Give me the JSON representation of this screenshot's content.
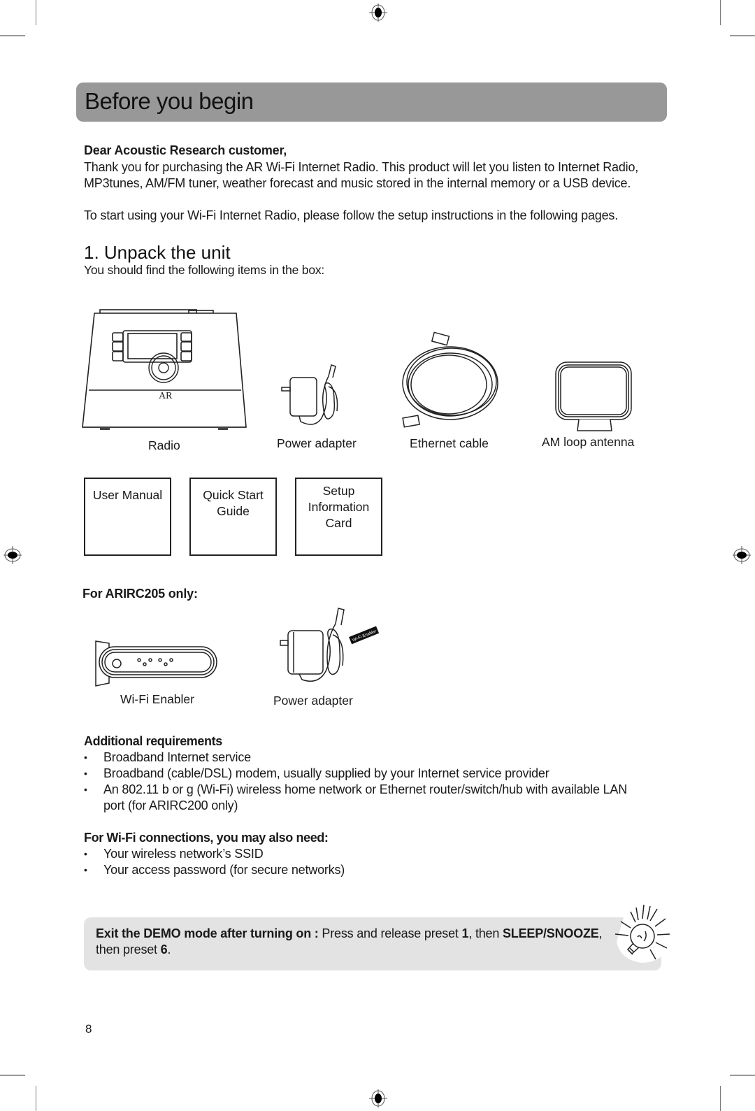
{
  "page": {
    "title": "Before you begin",
    "page_number": "8"
  },
  "intro": {
    "greeting": "Dear Acoustic Research customer,",
    "line1": "Thank you for purchasing the AR Wi-Fi Internet Radio. This product will let you listen to Internet Radio,",
    "line2": "MP3tunes, AM/FM tuner, weather forecast and music stored in the internal memory or a USB device.",
    "line3": "To start using your Wi-Fi Internet Radio, please follow the setup instructions in the following pages."
  },
  "unpack": {
    "heading": "1. Unpack the unit",
    "subheading": "You should find the following items in the box:",
    "items": [
      {
        "label": "Radio",
        "icon": "radio-illustration"
      },
      {
        "label": "Power adapter",
        "icon": "power-adapter-illustration"
      },
      {
        "label": "Ethernet cable",
        "icon": "ethernet-cable-illustration"
      },
      {
        "label": "AM loop antenna",
        "icon": "am-loop-antenna-illustration"
      }
    ],
    "documents": [
      {
        "lines": [
          "User Manual"
        ]
      },
      {
        "lines": [
          "Quick Start",
          "Guide"
        ]
      },
      {
        "lines": [
          "Setup",
          "Information",
          "Card"
        ]
      }
    ],
    "model_only_heading": "For ARIRC205 only:",
    "model_only_items": [
      {
        "label": "Wi-Fi Enabler",
        "icon": "wifi-enabler-illustration"
      },
      {
        "label": "Power adapter",
        "icon": "power-adapter-illustration",
        "tag_text": "Wi-Fi Enabler"
      }
    ]
  },
  "requirements": {
    "heading": "Additional requirements",
    "items": [
      "Broadband Internet service",
      "Broadband (cable/DSL) modem, usually supplied by your Internet service provider",
      "An 802.11 b or g (Wi-Fi) wireless home network or Ethernet router/switch/hub with available LAN",
      "port (for ARIRC200 only)"
    ]
  },
  "wifi_needs": {
    "heading": "For Wi-Fi connections, you may also need:",
    "items": [
      "Your wireless network’s SSID",
      "Your access password (for secure networks)"
    ]
  },
  "note": {
    "lead": "Exit the DEMO mode after turning on :",
    "t1": " Press and release preset ",
    "b1": "1",
    "t2": ", then ",
    "b2": "SLEEP/SNOOZE",
    "t3": ",",
    "t4": "then preset ",
    "b3": "6",
    "t5": ".",
    "icon": "lightbulb-icon"
  },
  "colors": {
    "title_bar": "#989898",
    "note_bg": "#e3e3e3"
  }
}
